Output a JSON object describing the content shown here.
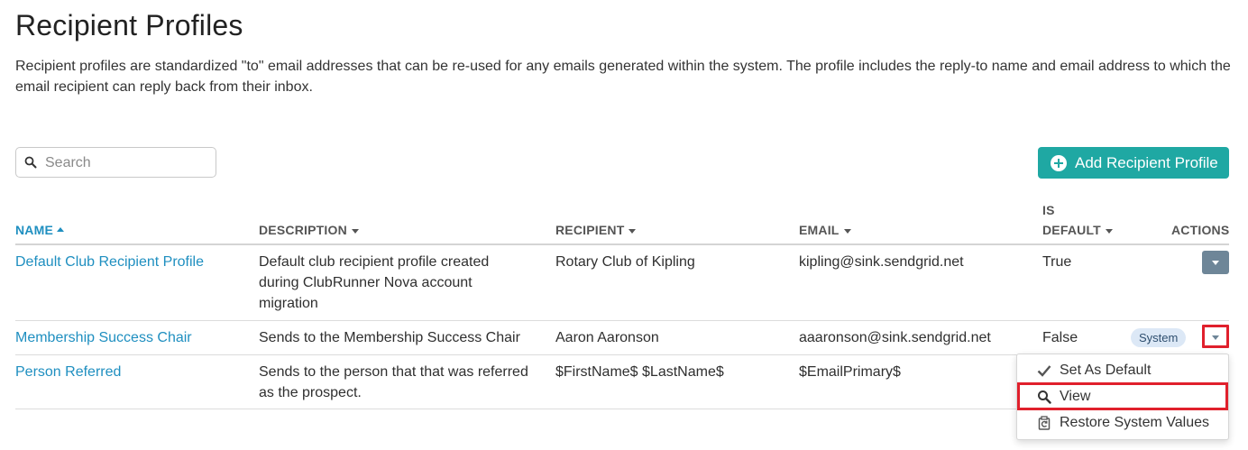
{
  "page": {
    "title": "Recipient Profiles",
    "description": "Recipient profiles are standardized \"to\" email addresses that can be re-used for any emails generated within the system. The profile includes the reply-to name and email address to which the email recipient can reply back from their inbox."
  },
  "search": {
    "placeholder": "Search",
    "icon": "search-icon"
  },
  "add_button": {
    "label": "Add Recipient Profile",
    "icon": "plus-circle-icon"
  },
  "table": {
    "headers": {
      "name": "NAME",
      "description": "DESCRIPTION",
      "recipient": "RECIPIENT",
      "email": "EMAIL",
      "is_default_line1": "IS",
      "is_default_line2": "DEFAULT",
      "actions": "ACTIONS"
    },
    "sort": {
      "column": "NAME",
      "direction": "ascending"
    },
    "rows": [
      {
        "name": "Default Club Recipient Profile",
        "description": "Default club recipient profile created during ClubRunner Nova account migration",
        "recipient": "Rotary Club of Kipling",
        "email": "kipling@sink.sendgrid.net",
        "is_default": "True",
        "badge": ""
      },
      {
        "name": "Membership Success Chair",
        "description": "Sends to the Membership Success Chair",
        "recipient": "Aaron Aaronson",
        "email": "aaaronson@sink.sendgrid.net",
        "is_default": "False",
        "badge": "System"
      },
      {
        "name": "Person Referred",
        "description": "Sends to the person that that was referred as the prospect.",
        "recipient": "$FirstName$ $LastName$",
        "email": "$EmailPrimary$",
        "is_default": "",
        "badge": ""
      }
    ]
  },
  "actions_menu": {
    "items": [
      {
        "label": "Set As Default",
        "icon": "check-icon"
      },
      {
        "label": "View",
        "icon": "search-icon",
        "highlighted": true
      },
      {
        "label": "Restore System Values",
        "icon": "restore-icon"
      }
    ]
  },
  "colors": {
    "accent": "#1fa8a3",
    "link": "#1f8fc0",
    "action_button": "#6e8698",
    "highlight_outline": "#e0202c",
    "badge_bg": "#dce8f6"
  }
}
